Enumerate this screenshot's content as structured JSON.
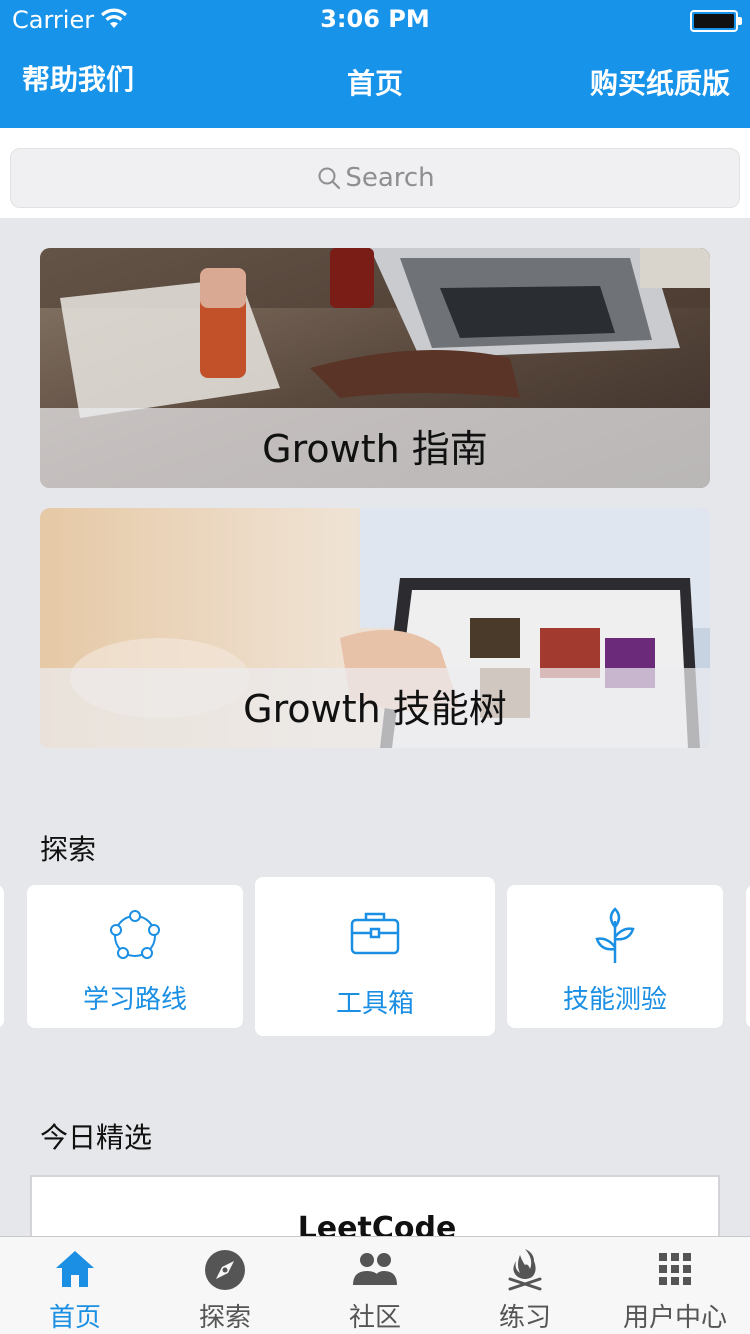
{
  "status_bar": {
    "carrier": "Carrier",
    "time": "3:06 PM"
  },
  "nav": {
    "left": "帮助我们",
    "title": "首页",
    "right": "购买纸质版"
  },
  "search": {
    "placeholder": "Search"
  },
  "banners": [
    {
      "caption": "Growth 指南"
    },
    {
      "caption": "Growth 技能树"
    }
  ],
  "explore": {
    "title": "探索",
    "cards": [
      {
        "label": "学习路线",
        "icon": "learning-path-icon"
      },
      {
        "label": "工具箱",
        "icon": "toolbox-icon"
      },
      {
        "label": "技能测验",
        "icon": "sprout-icon"
      }
    ]
  },
  "today": {
    "title": "今日精选",
    "card_title": "LeetCode"
  },
  "tabs": [
    {
      "label": "首页",
      "icon": "home-icon",
      "active": true
    },
    {
      "label": "探索",
      "icon": "compass-icon",
      "active": false
    },
    {
      "label": "社区",
      "icon": "people-icon",
      "active": false
    },
    {
      "label": "练习",
      "icon": "campfire-icon",
      "active": false
    },
    {
      "label": "用户中心",
      "icon": "grid-icon",
      "active": false
    }
  ],
  "colors": {
    "accent": "#1893ea",
    "link": "#1a8fe3",
    "background": "#e6e7ea"
  }
}
